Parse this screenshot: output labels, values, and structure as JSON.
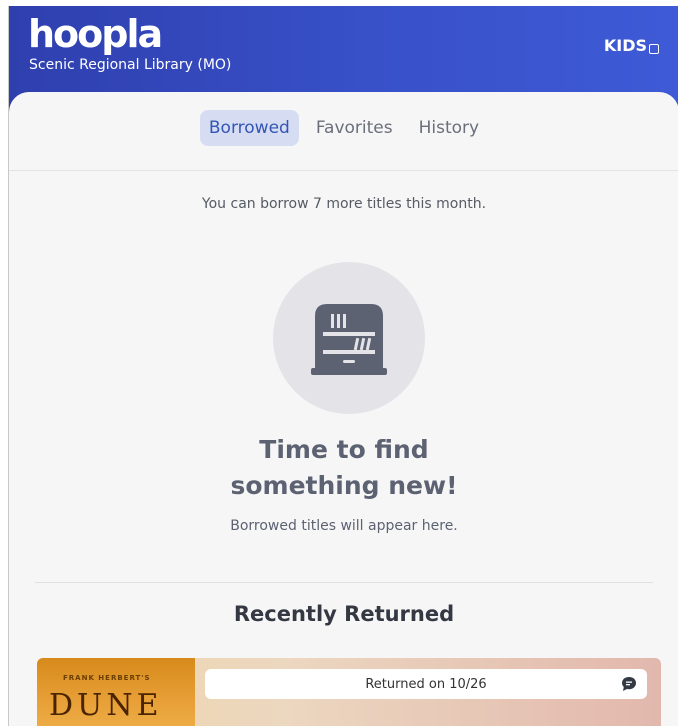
{
  "header": {
    "logo": "hoopla",
    "library": "Scenic Regional Library (MO)",
    "kids_label": "KIDS"
  },
  "tabs": [
    {
      "label": "Borrowed",
      "active": true
    },
    {
      "label": "Favorites",
      "active": false
    },
    {
      "label": "History",
      "active": false
    }
  ],
  "borrow_limit_text": "You can borrow 7 more titles this month.",
  "empty_state": {
    "icon": "bookshelf-icon",
    "headline_line1": "Time to find",
    "headline_line2": "something new!",
    "subtext": "Borrowed titles will appear here."
  },
  "recently_returned": {
    "title": "Recently Returned",
    "items": [
      {
        "cover_author": "FRANK HERBERT'S",
        "cover_title": "DUNE",
        "status": "Returned on 10/26"
      }
    ]
  },
  "colors": {
    "header": "#3851c9",
    "active_tab_bg": "#d6ddf3",
    "active_tab_text": "#3455b4"
  }
}
